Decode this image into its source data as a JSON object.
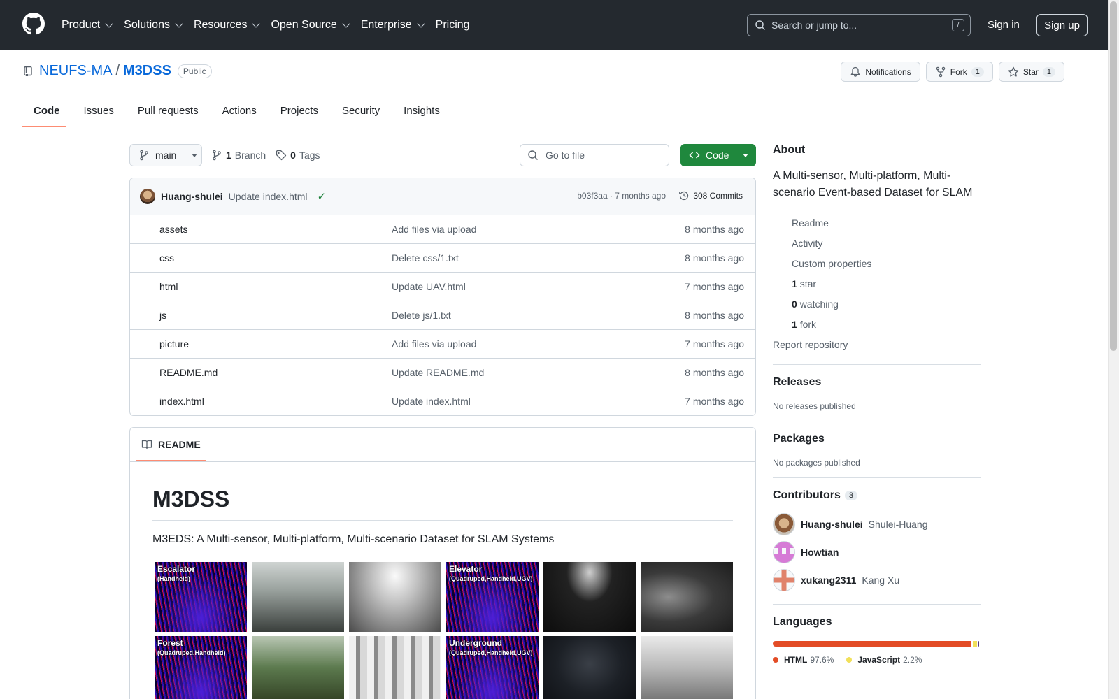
{
  "header": {
    "nav": [
      "Product",
      "Solutions",
      "Resources",
      "Open Source",
      "Enterprise",
      "Pricing"
    ],
    "nav_has_caret": [
      true,
      true,
      true,
      true,
      true,
      false
    ],
    "search_placeholder": "Search or jump to...",
    "search_shortcut": "/",
    "sign_in": "Sign in",
    "sign_up": "Sign up"
  },
  "repo": {
    "owner": "NEUFS-MA",
    "separator": "/",
    "name": "M3DSS",
    "visibility": "Public",
    "notifications_label": "Notifications",
    "fork_label": "Fork",
    "fork_count": "1",
    "star_label": "Star",
    "star_count": "1",
    "tabs": [
      "Code",
      "Issues",
      "Pull requests",
      "Actions",
      "Projects",
      "Security",
      "Insights"
    ],
    "active_tab": "Code"
  },
  "toolbar": {
    "branch": "main",
    "branch_count": "1",
    "branch_label": "Branch",
    "tag_count": "0",
    "tag_label": "Tags",
    "goto_file_placeholder": "Go to file",
    "code_button": "Code"
  },
  "latest_commit": {
    "author": "Huang-shulei",
    "message": "Update index.html",
    "status": "✓",
    "hash_time": "b03f3aa · 7 months ago",
    "commit_count": "308 Commits"
  },
  "files": [
    {
      "name": "assets",
      "type": "dir",
      "message": "Add files via upload",
      "date": "8 months ago"
    },
    {
      "name": "css",
      "type": "dir",
      "message": "Delete css/1.txt",
      "date": "8 months ago"
    },
    {
      "name": "html",
      "type": "dir",
      "message": "Update UAV.html",
      "date": "7 months ago"
    },
    {
      "name": "js",
      "type": "dir",
      "message": "Delete js/1.txt",
      "date": "8 months ago"
    },
    {
      "name": "picture",
      "type": "dir",
      "message": "Add files via upload",
      "date": "7 months ago"
    },
    {
      "name": "README.md",
      "type": "file",
      "message": "Update README.md",
      "date": "8 months ago"
    },
    {
      "name": "index.html",
      "type": "file",
      "message": "Update index.html",
      "date": "7 months ago"
    }
  ],
  "readme": {
    "tab_label": "README",
    "title": "M3DSS",
    "subtitle": "M3EDS: A Multi-sensor, Multi-platform, Multi-scenario Dataset for SLAM Systems",
    "images": [
      {
        "label": "Escalator",
        "sub": "(Handheld)",
        "style": "event"
      },
      {
        "label": "",
        "sub": "",
        "style": "rgb-escalator"
      },
      {
        "label": "",
        "sub": "",
        "style": "ir-escalator"
      },
      {
        "label": "Elevator",
        "sub": "(Quadruped,Handheld,UGV)",
        "style": "event"
      },
      {
        "label": "",
        "sub": "",
        "style": "dark-elevator"
      },
      {
        "label": "",
        "sub": "",
        "style": "ir-elevator"
      },
      {
        "label": "Forest",
        "sub": "(Quadruped,Handheld)",
        "style": "event"
      },
      {
        "label": "",
        "sub": "",
        "style": "rgb-forest"
      },
      {
        "label": "",
        "sub": "",
        "style": "ir-forest"
      },
      {
        "label": "Underground",
        "sub": "(Quadruped,Handheld,UGV)",
        "style": "event"
      },
      {
        "label": "",
        "sub": "",
        "style": "dark-underground"
      },
      {
        "label": "",
        "sub": "",
        "style": "ir-underground"
      }
    ]
  },
  "sidebar": {
    "about_title": "About",
    "about_desc": "A Multi-sensor, Multi-platform, Multi-scenario Event-based Dataset for SLAM",
    "links": [
      {
        "icon": "book-icon",
        "bold": "",
        "text": "Readme"
      },
      {
        "icon": "pulse-icon",
        "bold": "",
        "text": "Activity"
      },
      {
        "icon": "note-icon",
        "bold": "",
        "text": "Custom properties"
      },
      {
        "icon": "star-icon",
        "bold": "1",
        "text": "star"
      },
      {
        "icon": "eye-icon",
        "bold": "0",
        "text": "watching"
      },
      {
        "icon": "fork-icon",
        "bold": "1",
        "text": "fork"
      }
    ],
    "report": "Report repository",
    "releases_title": "Releases",
    "releases_text": "No releases published",
    "packages_title": "Packages",
    "packages_text": "No packages published",
    "contributors_title": "Contributors",
    "contributors_count": "3",
    "contributors": [
      {
        "login": "Huang-shulei",
        "name": "Shulei-Huang",
        "avatar": "photo"
      },
      {
        "login": "Howtian",
        "name": "",
        "avatar": "identicon-pink"
      },
      {
        "login": "xukang2311",
        "name": "Kang Xu",
        "avatar": "identicon-red"
      }
    ],
    "languages_title": "Languages",
    "languages": [
      {
        "name": "HTML",
        "pct": "97.6%",
        "value": 97.6,
        "color": "#e34c26"
      },
      {
        "name": "JavaScript",
        "pct": "2.2%",
        "value": 2.2,
        "color": "#f1e05a"
      },
      {
        "name": "",
        "pct": "",
        "value": 0.2,
        "color": "#563d7c"
      }
    ]
  }
}
